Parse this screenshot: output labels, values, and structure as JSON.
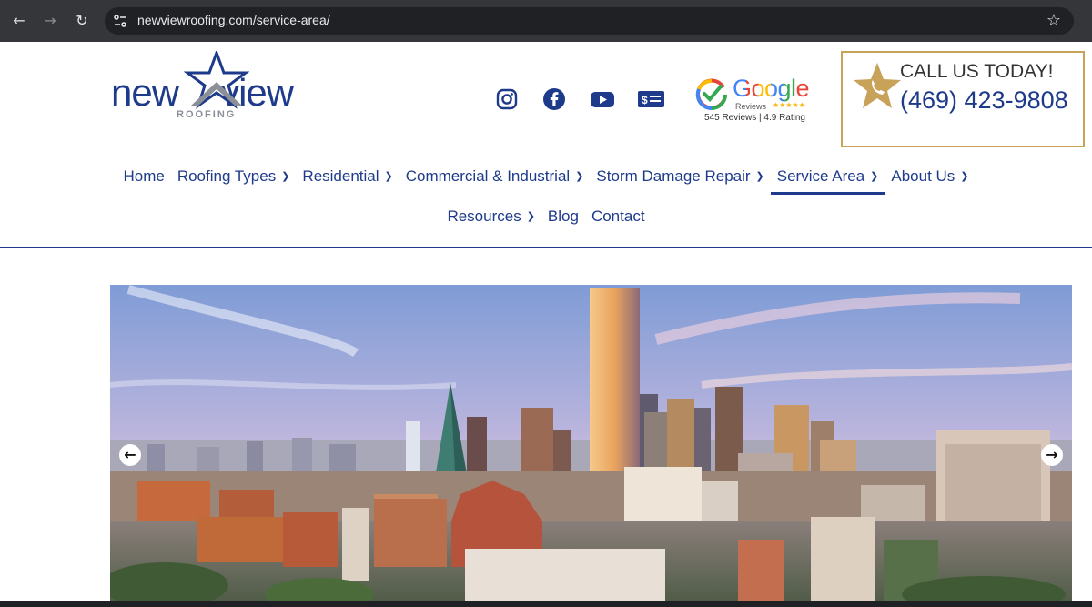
{
  "browser": {
    "url": "newviewroofing.com/service-area/"
  },
  "logo": {
    "wordmark_left": "new",
    "wordmark_right": "view",
    "subtitle": "ROOFING"
  },
  "social": [
    {
      "name": "instagram-icon"
    },
    {
      "name": "facebook-icon"
    },
    {
      "name": "youtube-icon"
    },
    {
      "name": "payment-icon"
    }
  ],
  "google_badge": {
    "word": "Google",
    "reviews_label": "Reviews",
    "meta": "545 Reviews | 4.9 Rating"
  },
  "call": {
    "title": "CALL US TODAY!",
    "number": "(469) 423-9808"
  },
  "menu": {
    "row1": [
      {
        "label": "Home",
        "dropdown": false,
        "active": false
      },
      {
        "label": "Roofing Types",
        "dropdown": true,
        "active": false
      },
      {
        "label": "Residential",
        "dropdown": true,
        "active": false
      },
      {
        "label": "Commercial & Industrial",
        "dropdown": true,
        "active": false
      },
      {
        "label": "Storm Damage Repair",
        "dropdown": true,
        "active": false
      },
      {
        "label": "Service Area",
        "dropdown": true,
        "active": true
      },
      {
        "label": "About Us",
        "dropdown": true,
        "active": false
      }
    ],
    "row2": [
      {
        "label": "Resources",
        "dropdown": true,
        "active": false
      },
      {
        "label": "Blog",
        "dropdown": false,
        "active": false
      },
      {
        "label": "Contact",
        "dropdown": false,
        "active": false
      }
    ]
  },
  "colors": {
    "brand_blue": "#1e3a8a",
    "gold": "#c9a25a"
  }
}
